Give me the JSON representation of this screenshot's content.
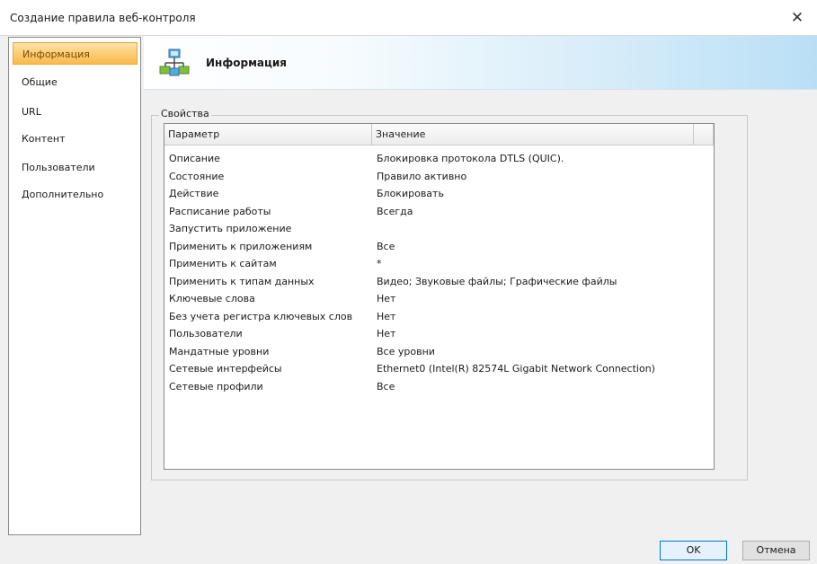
{
  "window": {
    "title": "Создание правила веб-контроля",
    "close_glyph": "✕"
  },
  "sidebar": {
    "items": [
      {
        "label": "Информация",
        "active": true
      },
      {
        "label": "Общие",
        "active": false
      },
      {
        "label": "URL",
        "active": false
      },
      {
        "label": "Контент",
        "active": false
      },
      {
        "label": "Пользователи",
        "active": false
      },
      {
        "label": "Дополнительно",
        "active": false
      }
    ]
  },
  "header": {
    "title": "Информация",
    "icon": "network-info-icon"
  },
  "properties": {
    "group_label": "Свойства",
    "columns": [
      "Параметр",
      "Значение"
    ],
    "rows": [
      [
        "Описание",
        "Блокировка протокола DTLS (QUIC)."
      ],
      [
        "Состояние",
        "Правило активно"
      ],
      [
        "Действие",
        "Блокировать"
      ],
      [
        "Расписание работы",
        "Всегда"
      ],
      [
        "Запустить приложение",
        ""
      ],
      [
        "Применить к приложениям",
        "Все"
      ],
      [
        "Применить к сайтам",
        "*"
      ],
      [
        "Применить к типам данных",
        "Видео; Звуковые файлы; Графические файлы"
      ],
      [
        "Ключевые слова",
        "Нет"
      ],
      [
        "Без учета регистра ключевых слов",
        "Нет"
      ],
      [
        "Пользователи",
        "Нет"
      ],
      [
        "Мандатные уровни",
        "Все уровни"
      ],
      [
        "Сетевые интерфейсы",
        "Ethernet0 (Intel(R) 82574L Gigabit Network Connection)"
      ],
      [
        "Сетевые профили",
        "Все"
      ]
    ]
  },
  "footer": {
    "ok_label": "OK",
    "cancel_label": "Отмена"
  },
  "colors": {
    "active_nav": "#fbb94a",
    "header_gradient_end": "#b9dff5",
    "ok_border": "#0078d7"
  }
}
